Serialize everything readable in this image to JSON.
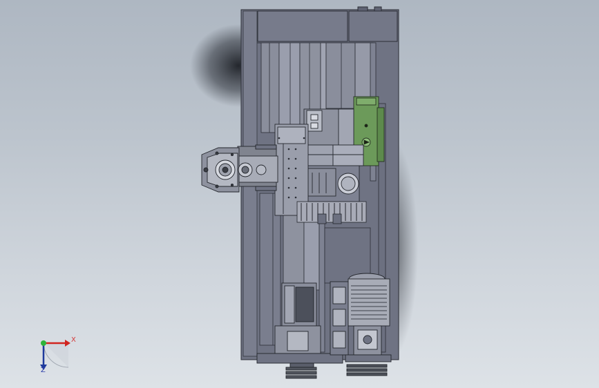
{
  "triad": {
    "x_label": "X",
    "z_label": "Z",
    "x_color": "#d0241f",
    "y_color": "#2fb33a",
    "z_color": "#1e3a9c"
  },
  "model_colors": {
    "frame": "#6f7383",
    "frame_light": "#7e8292",
    "rail": "#9a9ead",
    "gearbox": "#8e929f",
    "motor_green": "#6c9a5a",
    "gear": "#a8abb7",
    "shadow": "#20232a"
  }
}
